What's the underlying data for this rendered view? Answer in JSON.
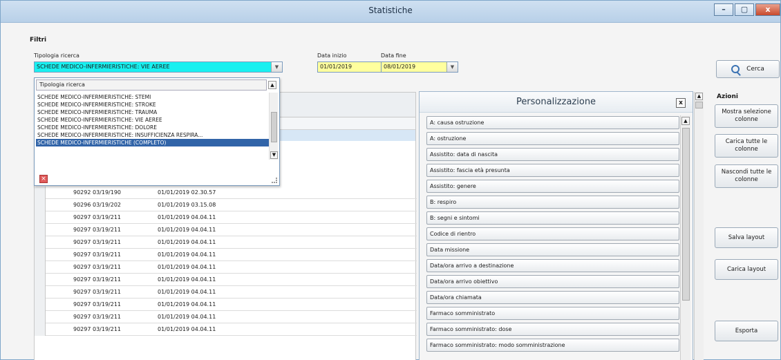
{
  "window": {
    "title": "Statistiche",
    "minimize": "–",
    "maximize": "▢",
    "close": "x"
  },
  "filters": {
    "section_title": "Filtri",
    "tipologia_label": "Tipologia ricerca",
    "tipologia_value": "SCHEDE MEDICO-INFERMIERISTICHE: VIE AEREE",
    "data_inizio_label": "Data inizio",
    "data_inizio_value": "01/01/2019",
    "data_fine_label": "Data fine",
    "data_fine_value": "08/01/2019",
    "search_label": "Cerca"
  },
  "dropdown": {
    "header": "Tipologia ricerca",
    "items": [
      "SCHEDE MEDICO-INFERMIERISTICHE: STEMI",
      "SCHEDE MEDICO-INFERMIERISTICHE: STROKE",
      "SCHEDE MEDICO-INFERMIERISTICHE: TRAUMA",
      "SCHEDE MEDICO-INFERMIERISTICHE: VIE AEREE",
      "SCHEDE MEDICO-INFERMIERISTICHE: DOLORE",
      "SCHEDE MEDICO-INFERMIERISTICHE: INSUFFICIENZA RESPIRA...",
      "SCHEDE MEDICO-INFERMIERISTICHE (COMPLETO)"
    ],
    "selected_index": 6
  },
  "grid": {
    "rows": [
      {
        "id": "90292 03/19/190",
        "date": "01/01/2019 02.30.57"
      },
      {
        "id": "90296 03/19/202",
        "date": "01/01/2019 03.15.08"
      },
      {
        "id": "90297 03/19/211",
        "date": "01/01/2019 04.04.11"
      },
      {
        "id": "90297 03/19/211",
        "date": "01/01/2019 04.04.11"
      },
      {
        "id": "90297 03/19/211",
        "date": "01/01/2019 04.04.11"
      },
      {
        "id": "90297 03/19/211",
        "date": "01/01/2019 04.04.11"
      },
      {
        "id": "90297 03/19/211",
        "date": "01/01/2019 04.04.11"
      },
      {
        "id": "90297 03/19/211",
        "date": "01/01/2019 04.04.11"
      },
      {
        "id": "90297 03/19/211",
        "date": "01/01/2019 04.04.11"
      },
      {
        "id": "90297 03/19/211",
        "date": "01/01/2019 04.04.11"
      },
      {
        "id": "90297 03/19/211",
        "date": "01/01/2019 04.04.11"
      },
      {
        "id": "90297 03/19/211",
        "date": "01/01/2019 04.04.11"
      }
    ]
  },
  "personalizzazione": {
    "title": "Personalizzazione",
    "close": "x",
    "items": [
      "A: causa ostruzione",
      "A: ostruzione",
      "Assistito: data di nascita",
      "Assistito: fascia età presunta",
      "Assistito: genere",
      "B: respiro",
      "B: segni e sintomi",
      "Codice di rientro",
      "Data missione",
      "Data/ora arrivo a destinazione",
      "Data/ora arrivo obiettivo",
      "Data/ora chiamata",
      "Farmaco somministrato",
      "Farmaco somministrato: dose",
      "Farmaco somministrato: modo somministrazione"
    ]
  },
  "azioni": {
    "title": "Azioni",
    "mostra": "Mostra selezione colonne",
    "carica_tutte": "Carica tutte le colonne",
    "nascondi": "Nascondi tutte le colonne",
    "salva_layout": "Salva layout",
    "carica_layout": "Carica layout",
    "esporta": "Esporta"
  },
  "colors": {
    "accent_combo": "#19f0f0",
    "selected_item": "#3164a8",
    "date_combo": "#ffff9e"
  }
}
